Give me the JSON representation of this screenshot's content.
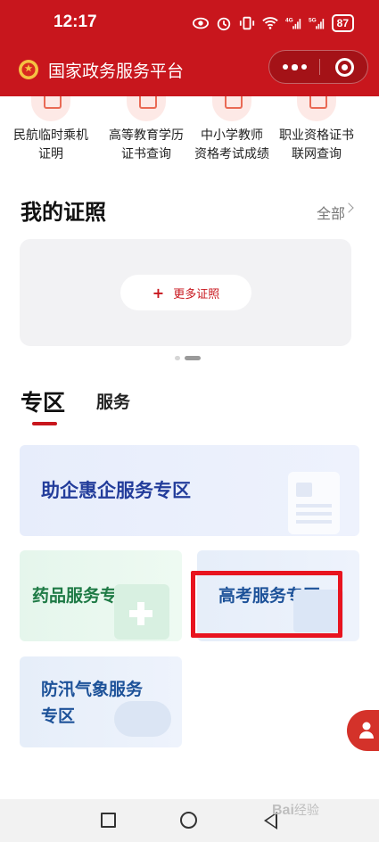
{
  "status_bar": {
    "time": "12:17",
    "icons": [
      "eye-icon",
      "alarm-icon",
      "vibrate-icon",
      "wifi-icon",
      "signal-4g-icon",
      "signal-5g-icon"
    ],
    "net_4g": "4G",
    "net_5g": "5G",
    "battery": "87"
  },
  "header": {
    "title": "国家政务服务平台",
    "bg_color": "#c8161d"
  },
  "quick_services": [
    {
      "line1": "民航临时乘机",
      "line2": "证明"
    },
    {
      "line1": "高等教育学历",
      "line2": "证书查询"
    },
    {
      "line1": "中小学教师",
      "line2": "资格考试成绩"
    },
    {
      "line1": "职业资格证书",
      "line2": "联网查询"
    }
  ],
  "licenses": {
    "title": "我的证照",
    "all_label": "全部",
    "more_button": "更多证照",
    "carousel_pages": 2,
    "carousel_active": 2
  },
  "tabs": {
    "zone": "专区",
    "service": "服务",
    "active": "专区"
  },
  "zones": {
    "enterprise": "助企惠企服务专区",
    "drug": "药品服务专区",
    "gaokao": "高考服务专区",
    "flood_line1": "防汛气象服务",
    "flood_line2": "专区"
  },
  "watermark": {
    "brand": "Bai",
    "suffix": "经验"
  }
}
